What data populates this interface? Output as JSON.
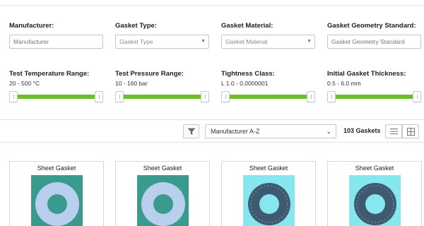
{
  "filters": {
    "manufacturer": {
      "label": "Manufacturer:",
      "placeholder": "Manufacturer"
    },
    "gasket_type": {
      "label": "Gasket Type:",
      "placeholder": "Gasket Type"
    },
    "gasket_material": {
      "label": "Gasket Material:",
      "placeholder": "Gasket Material"
    },
    "geometry_standard": {
      "label": "Gasket Geometry Standard:",
      "placeholder": "Gasket Geometry Standard"
    }
  },
  "ranges": {
    "temperature": {
      "label": "Test Temperature Range:",
      "value": "20 - 500 °C",
      "low": 0,
      "high": 1
    },
    "pressure": {
      "label": "Test Pressure Range:",
      "value": "10 - 160 bar",
      "low": 0,
      "high": 1
    },
    "tightness": {
      "label": "Tightness Class:",
      "value": "L 1.0 - 0.0000001",
      "low": 0,
      "high": 1
    },
    "thickness": {
      "label": "Initial Gasket Thickness:",
      "value": "0.5 - 6.0 mm",
      "low": 0,
      "high": 1
    }
  },
  "toolbar": {
    "filter_icon": "filter-funnel-icon",
    "sort_value": "Manufacturer A-Z",
    "count_label": "103 Gaskets",
    "list_icon": "list-view-icon",
    "grid_icon": "grid-view-icon"
  },
  "colors": {
    "slider_track": "#6cbf2a",
    "card_bg_dark": "#3a9a8e",
    "card_bg_light": "#86e8ee"
  },
  "cards": [
    {
      "title": "Sheet Gasket"
    },
    {
      "title": "Sheet Gasket"
    },
    {
      "title": "Sheet Gasket"
    },
    {
      "title": "Sheet Gasket"
    }
  ]
}
